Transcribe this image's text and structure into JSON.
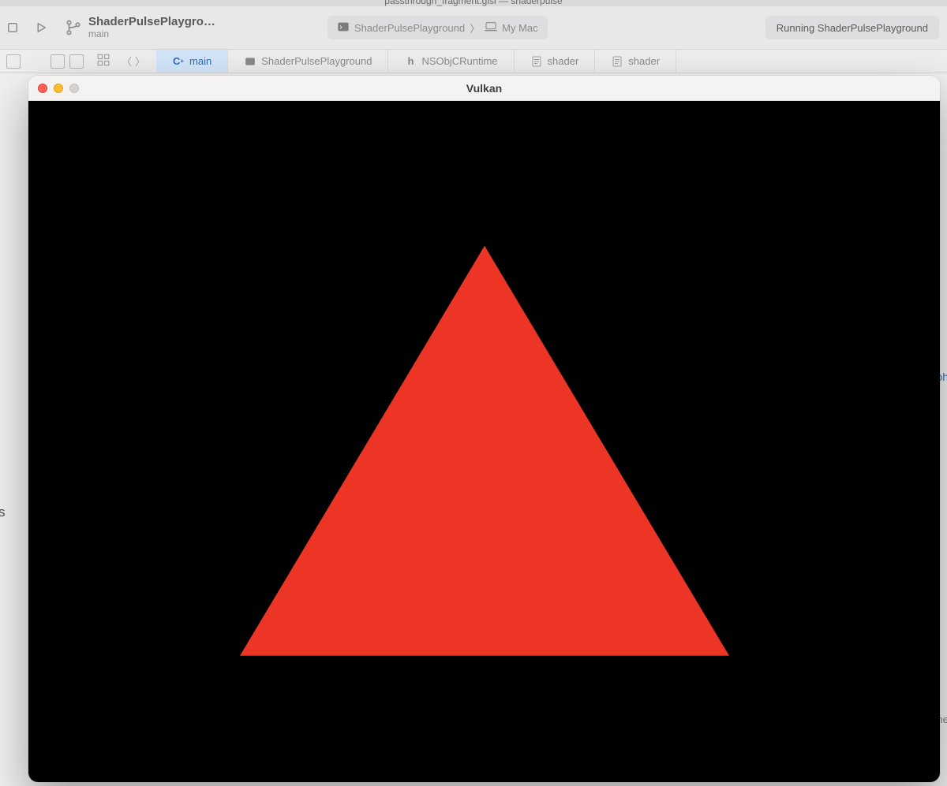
{
  "xcode": {
    "document_title": "passthrough_fragment.glsl — shaderpulse",
    "project_name": "ShaderPulsePlaygro…",
    "branch": "main",
    "scheme_target": "ShaderPulsePlayground",
    "scheme_device": "My Mac",
    "status_text": "Running ShaderPulsePlayground",
    "tabs": [
      {
        "icon": "c-plus",
        "label": "main",
        "active": true
      },
      {
        "icon": "terminal",
        "label": "ShaderPulsePlayground",
        "active": false
      },
      {
        "icon": "header",
        "label": "NSObjCRuntime",
        "active": false
      },
      {
        "icon": "doc",
        "label": "shader",
        "active": false
      },
      {
        "icon": "doc",
        "label": "shader",
        "active": false
      }
    ]
  },
  "app_window": {
    "title": "Vulkan",
    "canvas": {
      "background_color": "#000000",
      "shape": "triangle",
      "shape_color": "#ec3524"
    },
    "traffic_lights": [
      "close",
      "minimize",
      "disabled"
    ]
  },
  "edge_fragments": {
    "left_s": "s",
    "right_ph": "ph",
    "right_ne": "ne"
  }
}
